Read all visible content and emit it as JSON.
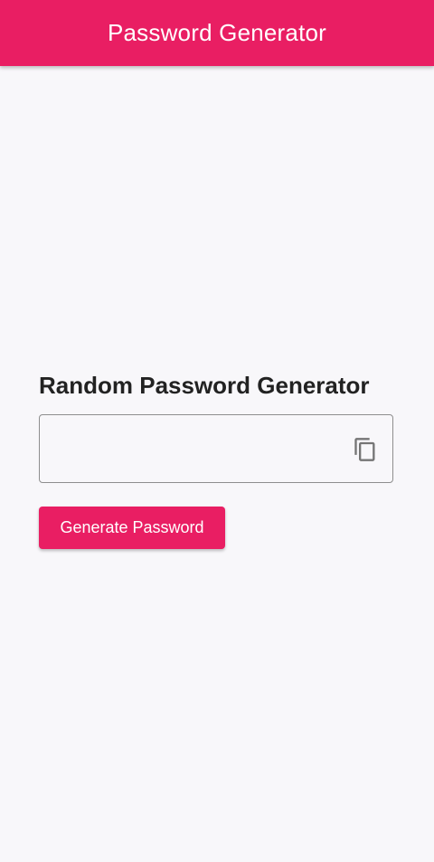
{
  "app_bar": {
    "title": "Password Generator",
    "color": "#e91e63"
  },
  "main": {
    "heading": "Random Password Generator",
    "password_field": {
      "value": "",
      "placeholder": "",
      "copy_icon": "copy-icon"
    },
    "generate_button": {
      "label": "Generate Password",
      "color": "#e91e63"
    }
  }
}
